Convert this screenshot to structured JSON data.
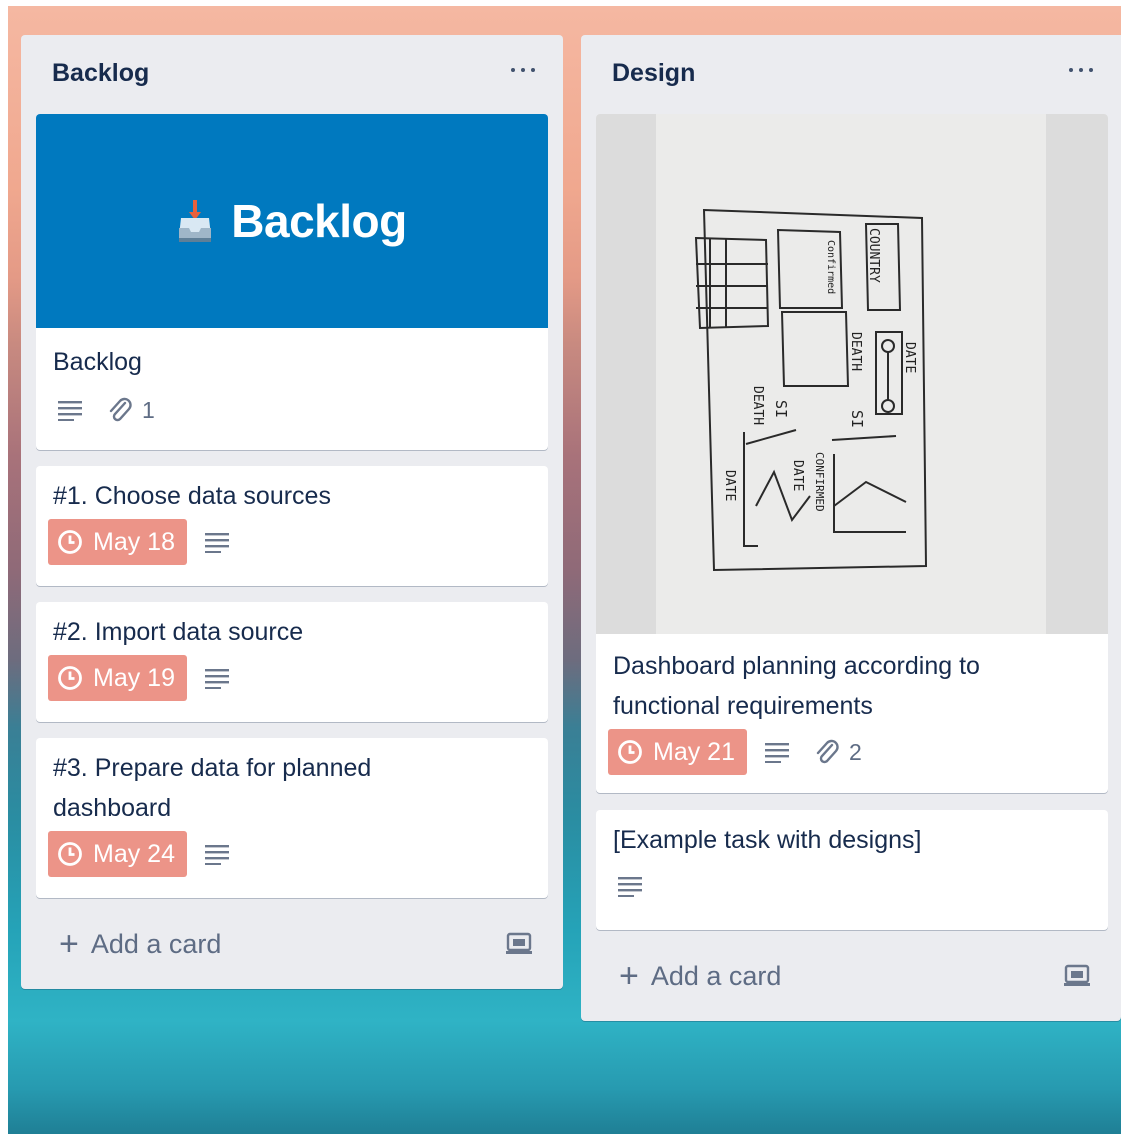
{
  "lists": [
    {
      "title": "Backlog",
      "cards": [
        {
          "cover_text": "Backlog",
          "title": "Backlog",
          "attachments": "1"
        },
        {
          "title": "#1. Choose data sources",
          "due": "May 18"
        },
        {
          "title": "#2. Import data source",
          "due": "May 19"
        },
        {
          "title": "#3. Prepare data for planned dashboard",
          "due": "May 24"
        }
      ],
      "add_card": "Add a card"
    },
    {
      "title": "Design",
      "cards": [
        {
          "title": "Dashboard planning according to functional requirements",
          "due": "May 21",
          "attachments": "2"
        },
        {
          "title": "[Example task with designs]"
        }
      ],
      "add_card": "Add a card"
    }
  ],
  "sketch_labels": {
    "country": "COUNTRY",
    "confirmed_small": "Confirmed",
    "death": "DEATH",
    "date": "DATE",
    "si_right": "SI",
    "si_left": "SI",
    "death_left": "DEATH",
    "date_left": "DATE",
    "date_mid": "DATE",
    "confirmed": "CONFIRMED"
  },
  "colors": {
    "cover": "#0079bf",
    "due_badge": "#ec9488",
    "list_bg": "#ebecf0",
    "text": "#172b4d"
  },
  "icons": [
    "inbox-icon",
    "description-icon",
    "paperclip-icon",
    "clock-icon",
    "ellipsis-icon",
    "plus-icon",
    "card-template-icon"
  ]
}
